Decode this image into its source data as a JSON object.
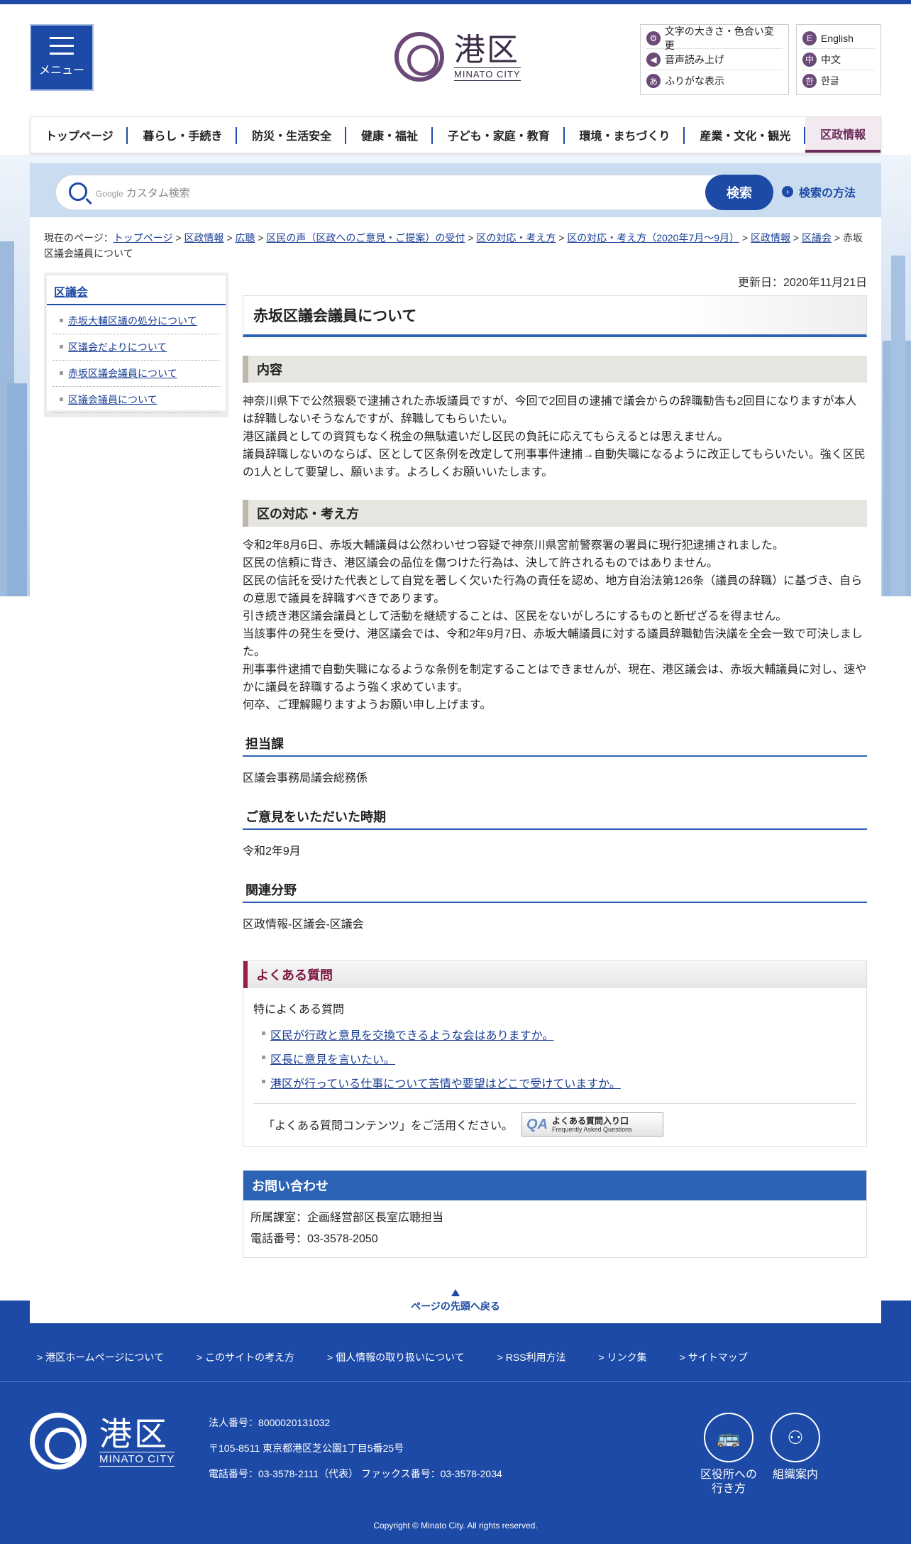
{
  "header": {
    "menu_label": "メニュー",
    "logo_ja": "港区",
    "logo_en": "MINATO CITY",
    "util": [
      "文字の大きさ・色合い変更",
      "音声読み上げ",
      "ふりがな表示"
    ],
    "util_icons": [
      "gear-icon",
      "speaker-icon",
      "furigana-icon"
    ],
    "lang": [
      "English",
      "中文",
      "한글"
    ],
    "lang_icons": [
      "E",
      "中",
      "한"
    ]
  },
  "nav": [
    "トップページ",
    "暮らし・手続き",
    "防災・生活安全",
    "健康・福祉",
    "子ども・家庭・教育",
    "環境・まちづくり",
    "産業・文化・観光",
    "区政情報"
  ],
  "search": {
    "google": "Google",
    "placeholder": "カスタム検索",
    "button": "検索",
    "how": "検索の方法"
  },
  "breadcrumb": {
    "prefix": "現在のページ：",
    "links": [
      "トップページ",
      "区政情報",
      "広聴",
      "区民の声（区政へのご意見・ご提案）の受付",
      "区の対応・考え方",
      "区の対応・考え方（2020年7月～9月）",
      "区政情報",
      "区議会"
    ],
    "current": "赤坂区議会議員について"
  },
  "sidebar": {
    "heading": "区議会",
    "items": [
      "赤坂大輔区議の処分について",
      "区議会だよりについて",
      "赤坂区議会議員について",
      "区議会議員について"
    ]
  },
  "main": {
    "updated": "更新日：2020年11月21日",
    "title": "赤坂区議会議員について",
    "section1_heading": "内容",
    "section1_lines": [
      "神奈川県下で公然猥褻で逮捕された赤坂議員ですが、今回で2回目の逮捕で議会からの辞職勧告も2回目になりますが本人は辞職しないそうなんですが、辞職してもらいたい。",
      "港区議員としての資質もなく税金の無駄遣いだし区民の負託に応えてもらえるとは思えません。",
      "議員辞職しないのならば、区として区条例を改定して刑事事件逮捕→自動失職になるように改正してもらいたい。強く区民の1人として要望し、願います。よろしくお願いいたします。"
    ],
    "section2_heading": "区の対応・考え方",
    "section2_lines": [
      "令和2年8月6日、赤坂大輔議員は公然わいせつ容疑で神奈川県宮前警察署の署員に現行犯逮捕されました。",
      "区民の信頼に背き、港区議会の品位を傷つけた行為は、決して許されるものではありません。",
      "区民の信託を受けた代表として自覚を著しく欠いた行為の責任を認め、地方自治法第126条（議員の辞職）に基づき、自らの意思で議員を辞職すべきであります。",
      "引き続き港区議会議員として活動を継続することは、区民をないがしろにするものと断ぜざるを得ません。",
      "当該事件の発生を受け、港区議会では、令和2年9月7日、赤坂大輔議員に対する議員辞職勧告決議を全会一致で可決しました。",
      "刑事事件逮捕で自動失職になるような条例を制定することはできませんが、現在、港区議会は、赤坂大輔議員に対し、速やかに議員を辞職するよう強く求めています。",
      "何卒、ご理解賜りますようお願い申し上げます。"
    ],
    "dept_heading": "担当課",
    "dept_value": "区議会事務局議会総務係",
    "period_heading": "ご意見をいただいた時期",
    "period_value": "令和2年9月",
    "field_heading": "関連分野",
    "field_value": "区政情報-区議会-区議会"
  },
  "faq": {
    "heading": "よくある質問",
    "lead": "特によくある質問",
    "items": [
      "区民が行政と意見を交換できるような会はありますか。",
      "区長に意見を言いたい。",
      "港区が行っている仕事について苦情や要望はどこで受けていますか。"
    ],
    "foot_text": "「よくある質問コンテンツ」をご活用ください。",
    "banner_q": "QA",
    "banner_t1": "よくある質問入り口",
    "banner_t2": "Frequently Asked Questions"
  },
  "contact": {
    "heading": "お問い合わせ",
    "room": "所属課室：企画経営部区長室広聴担当",
    "tel": "電話番号：03-3578-2050"
  },
  "footer": {
    "totop": "ページの先頭へ戻る",
    "links": [
      "> 港区ホームページについて",
      "> このサイトの考え方",
      "> 個人情報の取り扱いについて",
      "> RSS利用方法",
      "> リンク集",
      "> サイトマップ"
    ],
    "logo_ja": "港区",
    "logo_en": "MINATO CITY",
    "corp": "法人番号：8000020131032",
    "address": "〒105-8511 東京都港区芝公園1丁目5番25号",
    "phone": "電話番号：03-3578-2111（代表） ファックス番号：03-3578-2034",
    "icon1_label1": "区役所への",
    "icon1_label2": "行き方",
    "icon2_label": "組織案内",
    "copyright": "Copyright © Minato City. All rights reserved."
  },
  "colors": {
    "brand_blue": "#1d4aa6",
    "accent_purple": "#6b4a78",
    "faq_red": "#9a1b4e"
  }
}
